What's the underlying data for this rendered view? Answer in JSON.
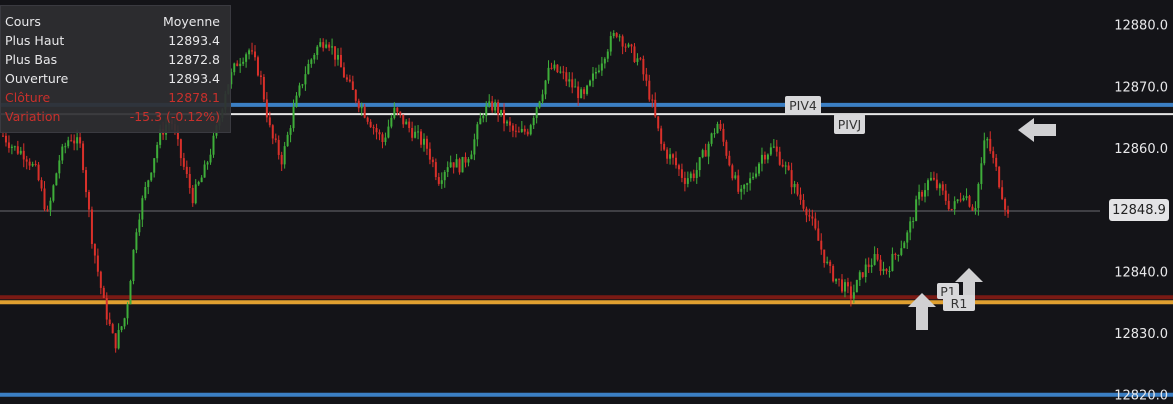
{
  "info_panel": {
    "header": {
      "label": "Cours",
      "value": "Moyenne"
    },
    "rows": [
      {
        "label": "Plus Haut",
        "value": "12893.4"
      },
      {
        "label": "Plus Bas",
        "value": "12872.8"
      },
      {
        "label": "Ouverture",
        "value": "12893.4"
      },
      {
        "label": "Clôture",
        "value": "12878.1"
      },
      {
        "label": "Variation",
        "value": "-15.3 (-0.12%)"
      }
    ]
  },
  "last_price_label": "12848.9",
  "level_tags": {
    "piv4": "PIV4",
    "pivj": "PIVJ",
    "p1": "P1",
    "r1": "R1"
  },
  "colors": {
    "background": "#141418",
    "up": "#3fae3a",
    "down": "#d9302a",
    "blue_line": "#3b7fc4",
    "white_line": "#e6e6e6",
    "orange_line": "#e0a030",
    "dark_red_line": "#7a1a14"
  },
  "chart_data": {
    "type": "candlestick",
    "ylim": [
      12818.5,
      12884.0
    ],
    "y_ticks": [
      "12820.0",
      "12830.0",
      "12840.0",
      "12850.0",
      "12860.0",
      "12870.0",
      "12880.0"
    ],
    "horizontal_levels": [
      {
        "name": "PIV4",
        "value": 12867.0,
        "color": "#3b7fc4"
      },
      {
        "name": "PIVJ",
        "value": 12865.5,
        "color": "#e6e6e6"
      },
      {
        "name": "P1",
        "value": 12835.8,
        "color": "#7a1a14"
      },
      {
        "name": "R1",
        "value": 12835.0,
        "color": "#e0a030"
      },
      {
        "value": 12820.0,
        "color": "#3b7fc4"
      }
    ],
    "last_price": 12848.9,
    "path": [
      12862,
      12860,
      12859,
      12856,
      12849,
      12858,
      12862,
      12860,
      12845,
      12835,
      12828,
      12833,
      12848,
      12855,
      12862,
      12865,
      12858,
      12852,
      12856,
      12862,
      12870,
      12874,
      12876,
      12872,
      12862,
      12858,
      12866,
      12872,
      12876,
      12878,
      12874,
      12870,
      12867,
      12864,
      12861,
      12866,
      12864,
      12862,
      12860,
      12855,
      12858,
      12857,
      12860,
      12866,
      12867,
      12864,
      12862,
      12863,
      12868,
      12873,
      12872,
      12870,
      12868,
      12872,
      12876,
      12879,
      12876,
      12874,
      12868,
      12860,
      12858,
      12855,
      12856,
      12860,
      12864,
      12858,
      12852,
      12855,
      12859,
      12860,
      12857,
      12853,
      12850,
      12845,
      12840,
      12838,
      12836,
      12840,
      12842,
      12840,
      12843,
      12846,
      12852,
      12855,
      12853,
      12850,
      12853,
      12850,
      12862,
      12856,
      12849
    ],
    "wick_range": 1.3
  }
}
